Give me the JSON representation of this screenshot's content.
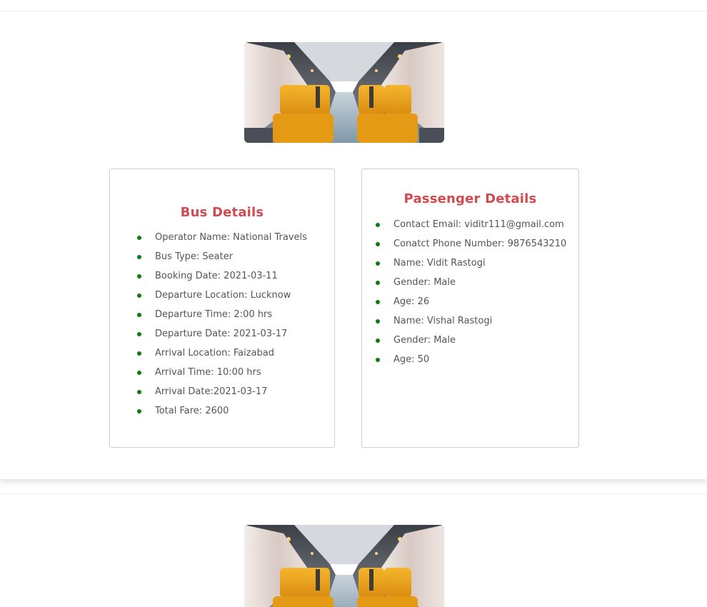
{
  "bookings": [
    {
      "bus_details": {
        "title": "Bus Details",
        "items": [
          "Operator Name: National Travels",
          "Bus Type: Seater",
          "Booking Date: 2021-03-11",
          "Departure Location: Lucknow",
          "Departure Time: 2:00 hrs",
          "Departure Date: 2021-03-17",
          "Arrival Location: Faizabad",
          "Arrival Time: 10:00 hrs",
          "Arrival Date:2021-03-17",
          "Total Fare: 2600"
        ]
      },
      "passenger_details": {
        "title": "Passenger Details",
        "items": [
          "Contact Email: viditr111@gmail.com",
          "Conatct Phone Number: 9876543210",
          "Name: Vidit Rastogi",
          "Gender: Male",
          "Age: 26",
          "Name: Vishal Rastogi",
          "Gender: Male",
          "Age: 50"
        ]
      }
    }
  ],
  "colors": {
    "heading": "#d04a4f",
    "bullet": "#0f7a0f",
    "text": "#555555",
    "seat": "#e6a21a"
  }
}
